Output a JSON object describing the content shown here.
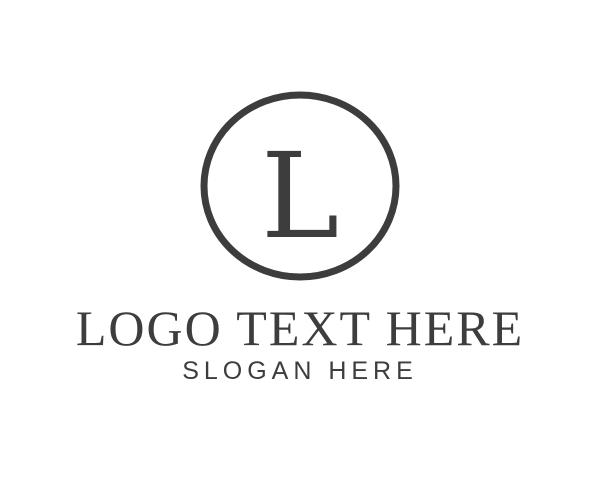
{
  "colors": {
    "background": "#ffffff",
    "ink": "#3d3d3d"
  },
  "logo": {
    "emblem_shape": "circle-ring",
    "monogram_letter": "L",
    "company_name": "LOGO TEXT HERE",
    "slogan": "SLOGAN HERE"
  }
}
